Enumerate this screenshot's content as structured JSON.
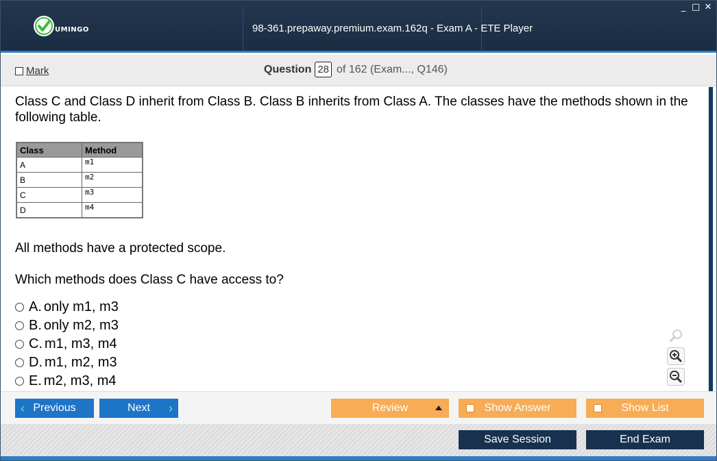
{
  "titlebar": {
    "logo_text": "UMINGO",
    "window_title": "98-361.prepaway.premium.exam.162q - Exam A - ETE Player",
    "controls": [
      "_",
      "□",
      "✕"
    ]
  },
  "header": {
    "mark_label": "Mark",
    "question_label": "Question",
    "question_number": "28",
    "question_of": "of 162 (Exam..., Q146)"
  },
  "question": {
    "text": "Class C and Class D inherit from Class B. Class B inherits from Class A. The classes have the methods shown in the following table.",
    "table": {
      "headers": [
        "Class",
        "Method"
      ],
      "rows": [
        [
          "A",
          "m1"
        ],
        [
          "B",
          "m2"
        ],
        [
          "C",
          "m3"
        ],
        [
          "D",
          "m4"
        ]
      ]
    },
    "statement": "All methods have a protected scope.",
    "prompt": "Which methods does Class C have access to?",
    "options": [
      {
        "letter": "A.",
        "text": "only m1, m3"
      },
      {
        "letter": "B.",
        "text": "only m2, m3"
      },
      {
        "letter": "C.",
        "text": "m1, m3, m4"
      },
      {
        "letter": "D.",
        "text": "m1, m2, m3"
      },
      {
        "letter": "E.",
        "text": "m2, m3, m4"
      }
    ]
  },
  "zoom_tools": [
    "search-icon",
    "zoom-in-icon",
    "zoom-out-icon"
  ],
  "nav": {
    "previous_label": "Previous",
    "next_label": "Next",
    "review_label": "Review",
    "show_answer_label": "Show Answer",
    "show_list_label": "Show List"
  },
  "footer": {
    "save_session_label": "Save Session",
    "end_exam_label": "End Exam"
  },
  "colors": {
    "titlebar": "#1e3148",
    "accent_blue": "#1e74c7",
    "orange": "#f7ac55",
    "dark_button": "#17314f",
    "logo_green": "#3dbb3d"
  }
}
